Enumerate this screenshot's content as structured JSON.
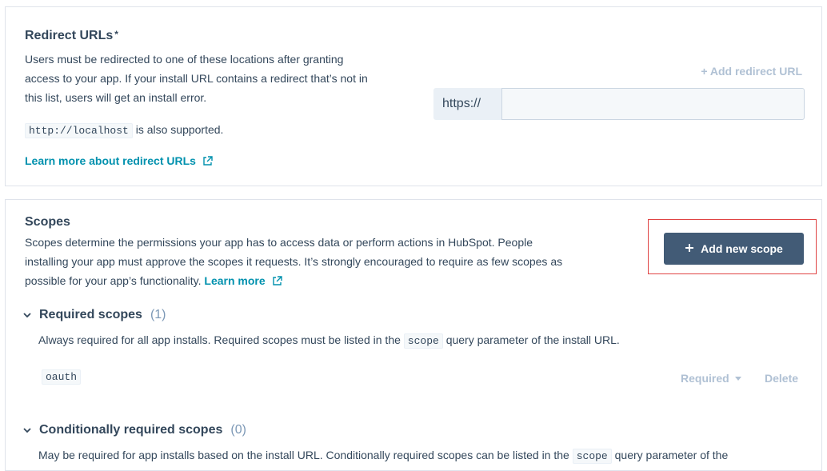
{
  "redirect": {
    "title": "Redirect URLs",
    "required_marker": "*",
    "description_lines": [
      "Users must be redirected to one of these locations after granting",
      "access to your app. If your install URL contains a redirect that’s not in",
      "this list, users will get an install error."
    ],
    "localhost_code": "http://localhost",
    "localhost_suffix": "is also supported.",
    "learn_more": "Learn more about redirect URLs",
    "add_redirect": "+ Add redirect URL",
    "input_prefix": "https://",
    "input_value": ""
  },
  "scopes": {
    "title": "Scopes",
    "description_lines": [
      "Scopes determine the permissions your app has to access data or perform actions in HubSpot. People",
      "installing your app must approve the scopes it requests. It’s strongly encouraged to require as few scopes as"
    ],
    "description_last": "possible for your app’s functionality.",
    "learn_more": "Learn more",
    "add_button": "Add new scope",
    "required": {
      "title": "Required scopes",
      "count": "(1)",
      "desc_prefix": "Always required for all app installs. Required scopes must be listed in the",
      "desc_code": "scope",
      "desc_suffix": "query parameter of the install URL.",
      "items": [
        {
          "name": "oauth",
          "status": "Required",
          "delete": "Delete"
        }
      ]
    },
    "conditional": {
      "title": "Conditionally required scopes",
      "count": "(0)",
      "desc_prefix": "May be required for app installs based on the install URL. Conditionally required scopes can be listed in the",
      "desc_code": "scope",
      "desc_suffix": "query parameter of the"
    }
  },
  "colors": {
    "accent_link": "#0091ae",
    "primary_button": "#425b76",
    "highlight_border": "#e04444",
    "text": "#33475b",
    "muted": "#b0c1d4"
  }
}
